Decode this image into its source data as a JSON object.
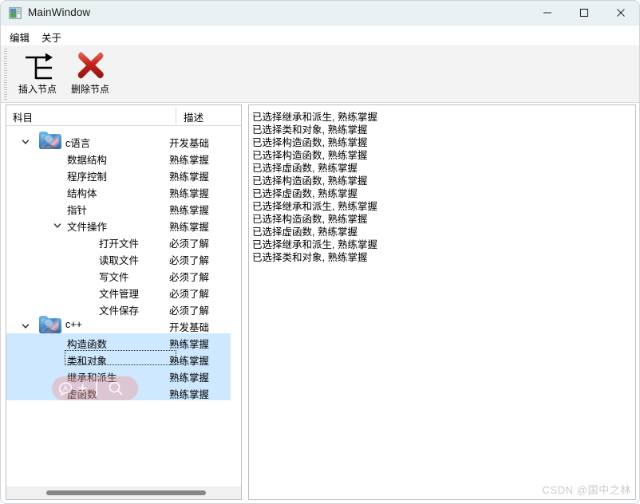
{
  "window": {
    "title": "MainWindow",
    "icon": "app-window-icon",
    "controls": {
      "minimize": "minimize-icon",
      "maximize": "maximize-icon",
      "close": "close-icon"
    }
  },
  "menubar": {
    "items": [
      {
        "label": "编辑",
        "name": "menu-edit"
      },
      {
        "label": "关于",
        "name": "menu-about"
      }
    ]
  },
  "toolbar": {
    "buttons": [
      {
        "label": "插入节点",
        "icon": "insert-node-icon"
      },
      {
        "label": "删除节点",
        "icon": "delete-node-icon"
      }
    ]
  },
  "tree": {
    "headers": {
      "subject": "科目",
      "description": "描述"
    },
    "rows": [
      {
        "name": "c语言",
        "desc": "开发基础",
        "indent": 0,
        "chevron": "expanded",
        "folder": true,
        "selected": false,
        "focused": false
      },
      {
        "name": "数据结构",
        "desc": "熟练掌握",
        "indent": 1,
        "chevron": "none",
        "folder": false,
        "selected": false,
        "focused": false
      },
      {
        "name": "程序控制",
        "desc": "熟练掌握",
        "indent": 1,
        "chevron": "none",
        "folder": false,
        "selected": false,
        "focused": false
      },
      {
        "name": "结构体",
        "desc": "熟练掌握",
        "indent": 1,
        "chevron": "none",
        "folder": false,
        "selected": false,
        "focused": false
      },
      {
        "name": "指针",
        "desc": "熟练掌握",
        "indent": 1,
        "chevron": "none",
        "folder": false,
        "selected": false,
        "focused": false
      },
      {
        "name": "文件操作",
        "desc": "熟练掌握",
        "indent": 1,
        "chevron": "expanded",
        "folder": false,
        "selected": false,
        "focused": false
      },
      {
        "name": "打开文件",
        "desc": "必须了解",
        "indent": 2,
        "chevron": "none",
        "folder": false,
        "selected": false,
        "focused": false
      },
      {
        "name": "读取文件",
        "desc": "必须了解",
        "indent": 2,
        "chevron": "none",
        "folder": false,
        "selected": false,
        "focused": false
      },
      {
        "name": "写文件",
        "desc": "必须了解",
        "indent": 2,
        "chevron": "none",
        "folder": false,
        "selected": false,
        "focused": false
      },
      {
        "name": "文件管理",
        "desc": "必须了解",
        "indent": 2,
        "chevron": "none",
        "folder": false,
        "selected": false,
        "focused": false
      },
      {
        "name": "文件保存",
        "desc": "必须了解",
        "indent": 2,
        "chevron": "none",
        "folder": false,
        "selected": false,
        "focused": false
      },
      {
        "name": "c++",
        "desc": "开发基础",
        "indent": 0,
        "chevron": "expanded",
        "folder": true,
        "selected": false,
        "focused": false
      },
      {
        "name": "构造函数",
        "desc": "熟练掌握",
        "indent": 1,
        "chevron": "none",
        "folder": false,
        "selected": true,
        "focused": false
      },
      {
        "name": "类和对象",
        "desc": "熟练掌握",
        "indent": 1,
        "chevron": "none",
        "folder": false,
        "selected": true,
        "focused": true
      },
      {
        "name": "继承和派生",
        "desc": "熟练掌握",
        "indent": 1,
        "chevron": "none",
        "folder": false,
        "selected": true,
        "focused": false
      },
      {
        "name": "虚函数",
        "desc": "熟练掌握",
        "indent": 1,
        "chevron": "none",
        "folder": false,
        "selected": true,
        "focused": false
      }
    ]
  },
  "log": {
    "lines": [
      "已选择继承和派生, 熟练掌握",
      "已选择类和对象, 熟练掌握",
      "已选择构造函数, 熟练掌握",
      "已选择构造函数, 熟练掌握",
      "已选择虚函数, 熟练掌握",
      "已选择构造函数, 熟练掌握",
      "已选择虚函数, 熟练掌握",
      "已选择继承和派生, 熟练掌握",
      "已选择构造函数, 熟练掌握",
      "已选择虚函数, 熟练掌握",
      "已选择继承和派生, 熟练掌握",
      "已选择类和对象, 熟练掌握"
    ]
  },
  "float_widget": {
    "translate_icon": "translate-a-icon",
    "add_icon": "plus-icon",
    "search_icon": "search-icon"
  },
  "watermark": {
    "text": "CSDN @国中之林"
  },
  "colors": {
    "titlebar": "#eaf1f3",
    "toolbar": "#f3f3f3",
    "selection": "#cde8ff",
    "delete_icon": "#c0241c",
    "widget_pink": "#f49696"
  }
}
